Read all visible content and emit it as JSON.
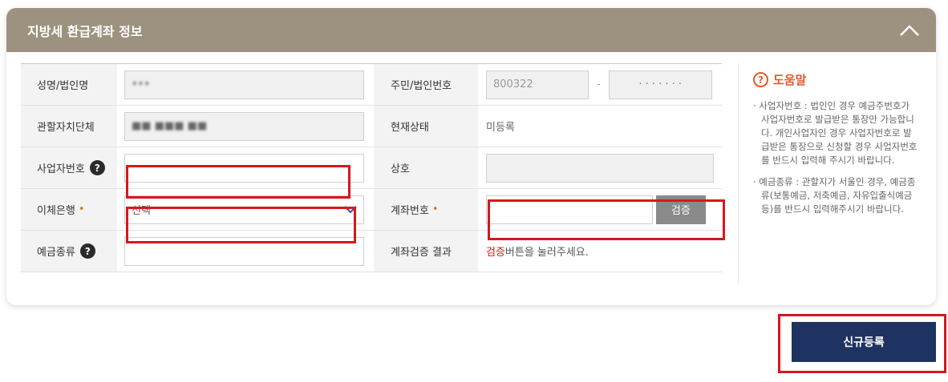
{
  "panel": {
    "title": "지방세 환급계좌 정보"
  },
  "rows": {
    "name": {
      "label": "성명/법인명",
      "value": "•••"
    },
    "idnum": {
      "label": "주민/법인번호",
      "front": "800322",
      "dash": "-",
      "back": "· · · · · · ·"
    },
    "region": {
      "label": "관할자치단체",
      "value": "■■ ■■■ ■■"
    },
    "status": {
      "label": "현재상태",
      "value": "미등록"
    },
    "bizno": {
      "label": "사업자번호",
      "value": ""
    },
    "company": {
      "label": "상호",
      "value": ""
    },
    "bank": {
      "label": "이체은행",
      "required_mark": "•",
      "selected": "선택"
    },
    "account": {
      "label": "계좌번호",
      "required_mark": "•",
      "value": "",
      "verify_label": "검증"
    },
    "deposit": {
      "label": "예금종류",
      "value": ""
    },
    "verify_result": {
      "label": "계좌검증 결과",
      "em": "검증",
      "rest": "버튼을 눌러주세요."
    }
  },
  "help": {
    "title": "도움말",
    "q_glyph": "?",
    "items": [
      "· 사업자번호 : 법인인 경우 예금주번호가 사업자번호로 발급받은 통장만 가능합니다. 개인사업자인 경우 사업자번호로 발급받은 통장으로 신청할 경우 사업자번호를 반드시 입력해 주시기 바랍니다.",
      "· 예금종류 : 관할지가 서울인 경우, 예금종류(보통예금, 저축예금, 자유입출식예금등)를 반드시 입력해주시기 바랍니다."
    ]
  },
  "submit_label": "신규등록",
  "colors": {
    "header": "#9d917f",
    "submit": "#1f3362",
    "highlight": "#d6171f",
    "help_accent": "#e2592b"
  }
}
